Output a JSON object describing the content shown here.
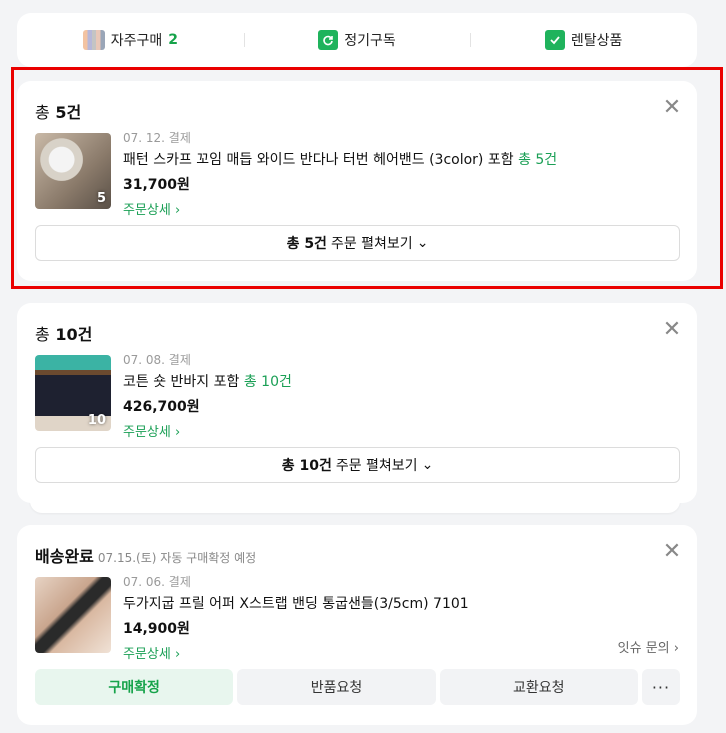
{
  "tabs": [
    {
      "label": "자주구매",
      "count": "2",
      "icon": "frequent-purchase-icon"
    },
    {
      "label": "정기구독",
      "icon": "subscription-icon"
    },
    {
      "label": "렌탈상품",
      "icon": "rental-icon"
    }
  ],
  "order1": {
    "summary_prefix": "총",
    "summary_count": "5건",
    "thumb_badge": "5",
    "date": "07. 12. 결제",
    "product": "패턴 스카프 꼬임 매듭 와이드 반다나 터번 헤어밴드 (3color) 포함",
    "total_label": "총 5건",
    "price": "31,700원",
    "detail_label": "주문상세",
    "expand_bold": "총 5건",
    "expand_rest": "주문 펼쳐보기"
  },
  "order2": {
    "summary_prefix": "총",
    "summary_count": "10건",
    "thumb_badge": "10",
    "date": "07. 08. 결제",
    "product": "코튼 숏 반바지 포함",
    "total_label": "총 10건",
    "price": "426,700원",
    "detail_label": "주문상세",
    "expand_bold": "총 10건",
    "expand_rest": "주문 펼쳐보기"
  },
  "order3": {
    "status": "배송완료",
    "status_note": "07.15.(토) 자동 구매확정 예정",
    "date": "07. 06. 결제",
    "product": "두가지굽 프릴 어퍼 X스트랩 밴딩 통굽샌들(3/5cm) 7101",
    "price": "14,900원",
    "detail_label": "주문상세",
    "issue_label": "잇슈 문의",
    "actions": {
      "confirm": "구매확정",
      "return": "반품요청",
      "exchange": "교환요청",
      "more": "···"
    }
  },
  "colors": {
    "accent_green": "#1a9f55",
    "highlight_red": "#ea0000"
  }
}
